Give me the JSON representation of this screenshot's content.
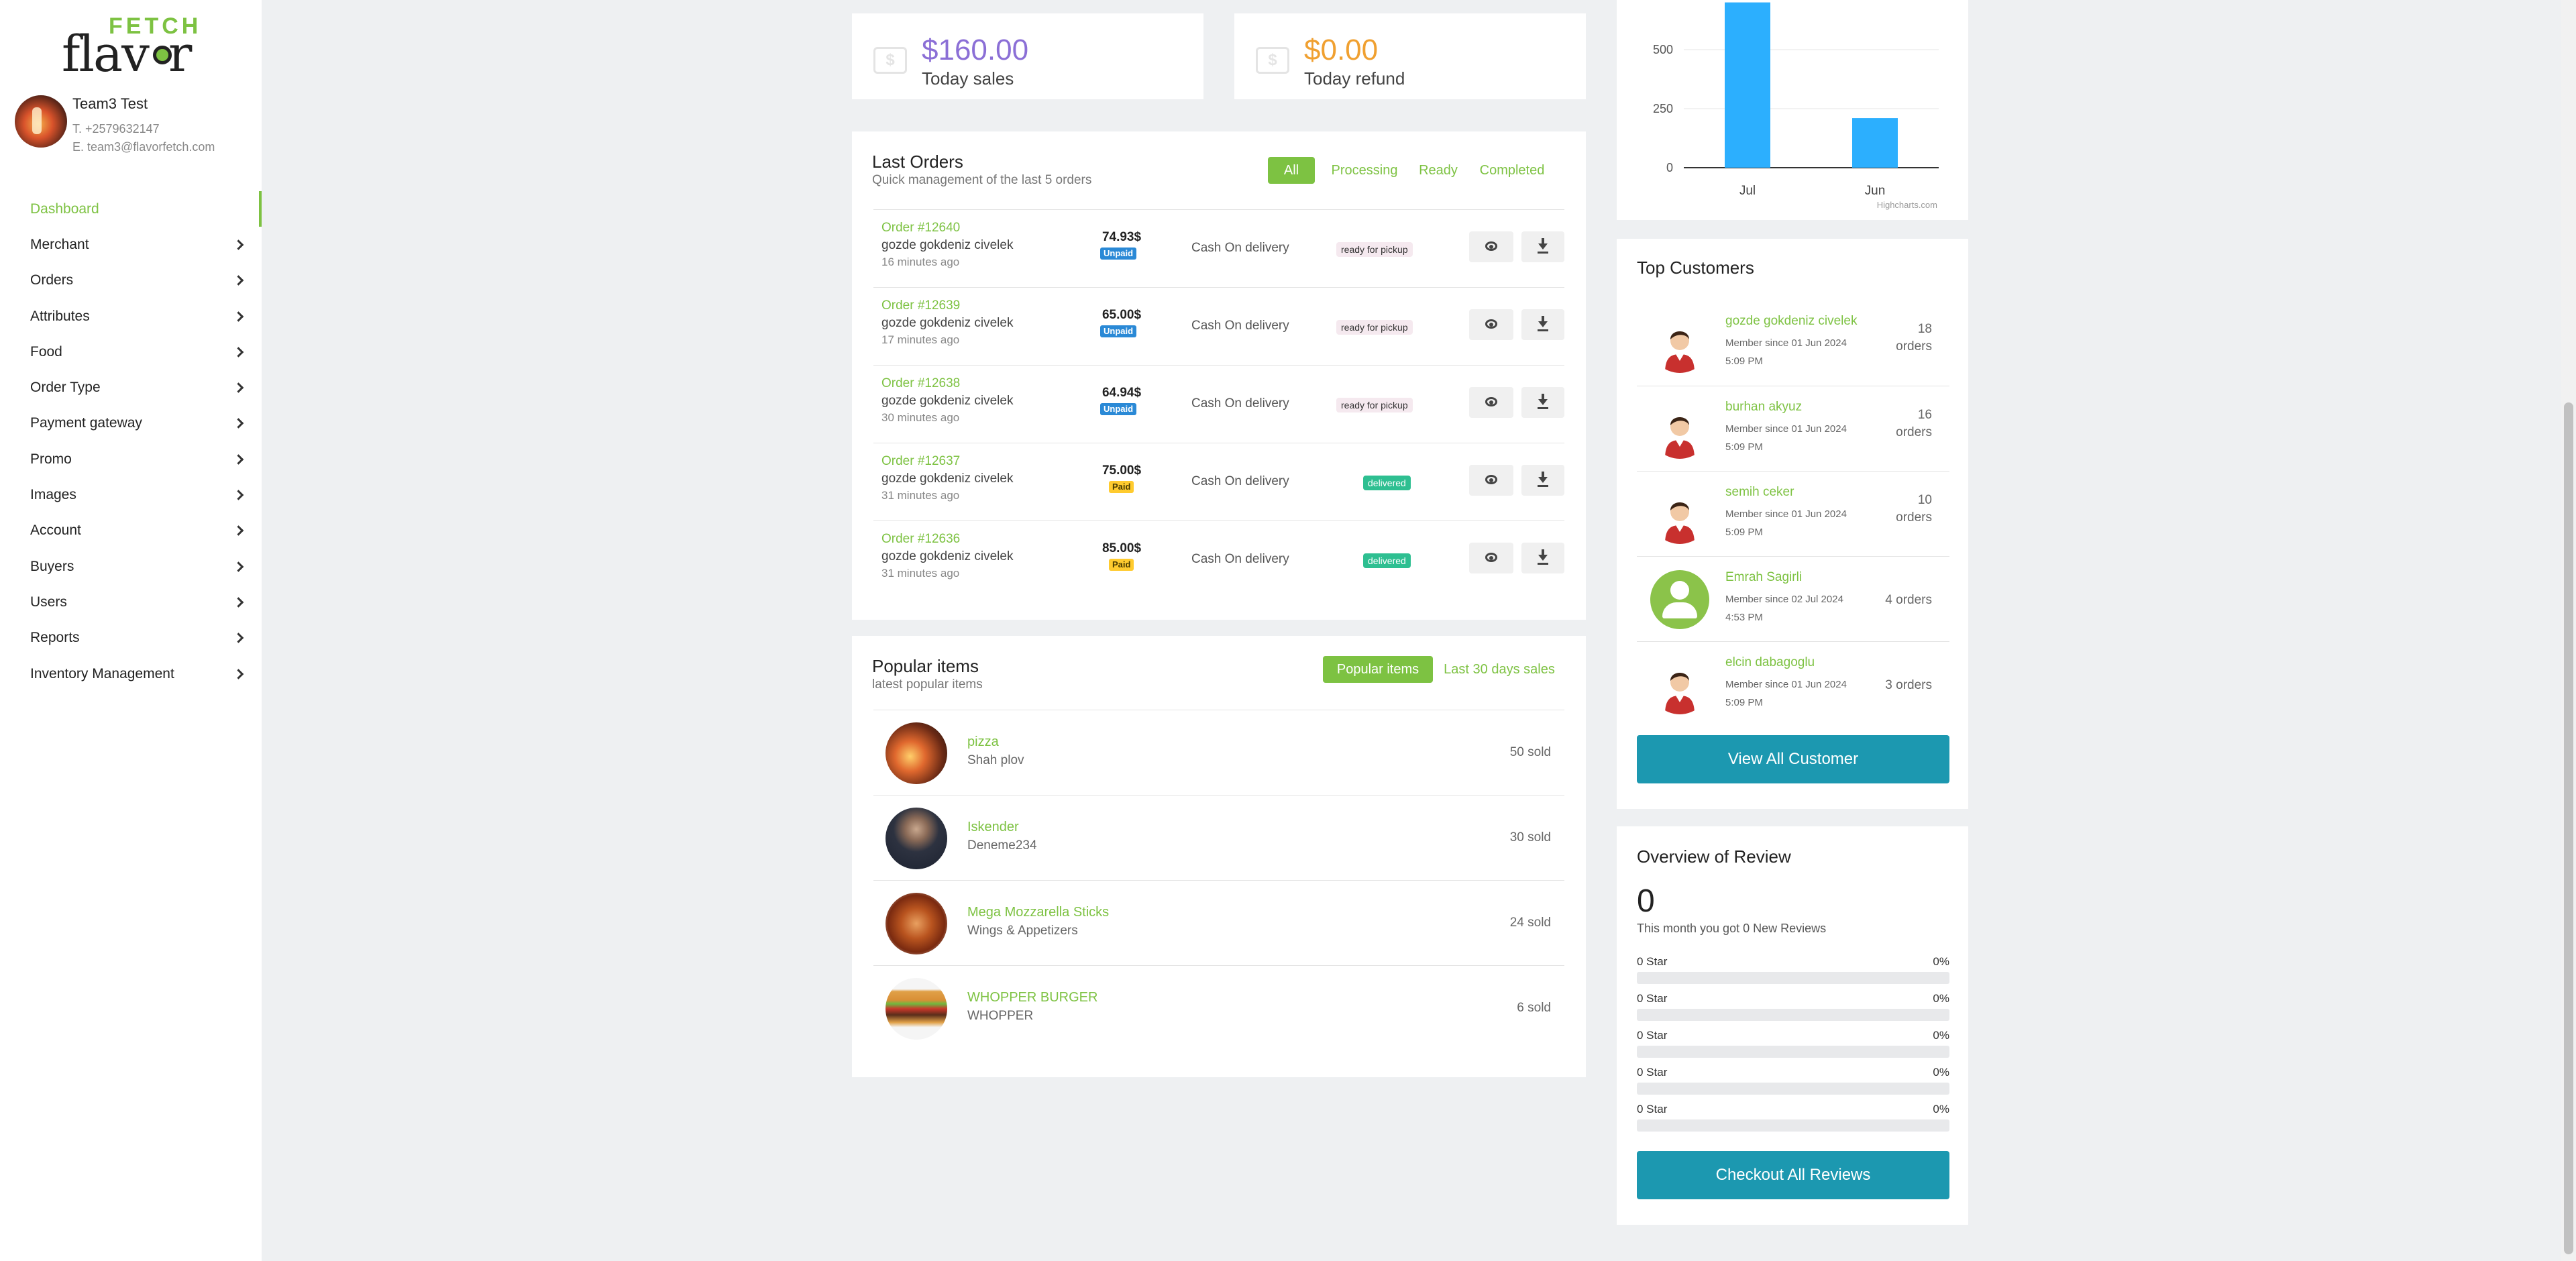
{
  "brand": {
    "fetch": "FETCH",
    "flavor": "flav",
    "flavor_end": "r"
  },
  "profile": {
    "name": "Team3 Test",
    "phone": "T. +2579632147",
    "email": "E. team3@flavorfetch.com"
  },
  "nav": [
    {
      "label": "Dashboard",
      "active": true
    },
    {
      "label": "Merchant"
    },
    {
      "label": "Orders"
    },
    {
      "label": "Attributes"
    },
    {
      "label": "Food"
    },
    {
      "label": "Order Type"
    },
    {
      "label": "Payment gateway"
    },
    {
      "label": "Promo"
    },
    {
      "label": "Images"
    },
    {
      "label": "Account"
    },
    {
      "label": "Buyers"
    },
    {
      "label": "Users"
    },
    {
      "label": "Reports"
    },
    {
      "label": "Inventory Management"
    }
  ],
  "stats": {
    "sales": {
      "value": "$160.00",
      "label": "Today sales",
      "color": "#8b6fd6"
    },
    "refund": {
      "value": "$0.00",
      "label": "Today refund",
      "color": "#f0a030"
    }
  },
  "last_orders": {
    "title": "Last Orders",
    "subtitle": "Quick management of the last 5 orders",
    "filters": [
      "All",
      "Processing",
      "Ready",
      "Completed"
    ],
    "rows": [
      {
        "id": "Order #12640",
        "customer": "gozde gokdeniz civelek",
        "time": "16 minutes ago",
        "price": "74.93$",
        "payment": "Unpaid",
        "method": "Cash On delivery",
        "status": "ready for pickup"
      },
      {
        "id": "Order #12639",
        "customer": "gozde gokdeniz civelek",
        "time": "17 minutes ago",
        "price": "65.00$",
        "payment": "Unpaid",
        "method": "Cash On delivery",
        "status": "ready for pickup"
      },
      {
        "id": "Order #12638",
        "customer": "gozde gokdeniz civelek",
        "time": "30 minutes ago",
        "price": "64.94$",
        "payment": "Unpaid",
        "method": "Cash On delivery",
        "status": "ready for pickup"
      },
      {
        "id": "Order #12637",
        "customer": "gozde gokdeniz civelek",
        "time": "31 minutes ago",
        "price": "75.00$",
        "payment": "Paid",
        "method": "Cash On delivery",
        "status": "delivered"
      },
      {
        "id": "Order #12636",
        "customer": "gozde gokdeniz civelek",
        "time": "31 minutes ago",
        "price": "85.00$",
        "payment": "Paid",
        "method": "Cash On delivery",
        "status": "delivered"
      }
    ]
  },
  "popular": {
    "title": "Popular items",
    "subtitle": "latest popular items",
    "tabs": [
      "Popular items",
      "Last 30 days sales"
    ],
    "items": [
      {
        "name": "pizza",
        "category": "Shah plov",
        "sold": "50 sold",
        "img": "pizza-photo"
      },
      {
        "name": "Iskender",
        "category": "Deneme234",
        "sold": "30 sold",
        "img": "portrait-photo"
      },
      {
        "name": "Mega Mozzarella Sticks",
        "category": "Wings & Appetizers",
        "sold": "24 sold",
        "img": "wings-photo"
      },
      {
        "name": "WHOPPER BURGER",
        "category": "WHOPPER",
        "sold": "6 sold",
        "img": "burger-photo"
      }
    ]
  },
  "chart_data": {
    "type": "bar",
    "categories": [
      "Jul",
      "Jun"
    ],
    "values": [
      700,
      210
    ],
    "yticks": [
      "0",
      "250",
      "500"
    ],
    "ylim": [
      0,
      750
    ],
    "credit": "Highcharts.com",
    "color": "#2caffe"
  },
  "top_customers": {
    "title": "Top Customers",
    "rows": [
      {
        "name": "gozde gokdeniz civelek",
        "since": "Member since 01 Jun 2024 5:09 PM",
        "orders_n": "18",
        "orders_w": "orders",
        "avatar": "male-avatar"
      },
      {
        "name": "burhan akyuz",
        "since": "Member since 01 Jun 2024 5:09 PM",
        "orders_n": "16",
        "orders_w": "orders",
        "avatar": "male-avatar"
      },
      {
        "name": "semih ceker",
        "since": "Member since 01 Jun 2024 5:09 PM",
        "orders_n": "10",
        "orders_w": "orders",
        "avatar": "male-avatar"
      },
      {
        "name": "Emrah Sagirli",
        "since": "Member since 02 Jul 2024 4:53 PM",
        "orders_full": "4 orders",
        "avatar": "default-user-avatar"
      },
      {
        "name": "elcin dabagoglu",
        "since": "Member since 01 Jun 2024 5:09 PM",
        "orders_full": "3 orders",
        "avatar": "male-avatar"
      }
    ],
    "button": "View All Customer"
  },
  "review": {
    "title": "Overview of Review",
    "count": "0",
    "note": "This month you got 0 New Reviews",
    "rows": [
      {
        "label": "0 Star",
        "pct": "0%"
      },
      {
        "label": "0 Star",
        "pct": "0%"
      },
      {
        "label": "0 Star",
        "pct": "0%"
      },
      {
        "label": "0 Star",
        "pct": "0%"
      },
      {
        "label": "0 Star",
        "pct": "0%"
      }
    ],
    "button": "Checkout All Reviews"
  },
  "colors": {
    "accent": "#7dc242",
    "teal": "#1c98b0",
    "unpaid": "#2a89d6",
    "paid": "#ffcb2f",
    "delivered": "#2ebf91"
  }
}
